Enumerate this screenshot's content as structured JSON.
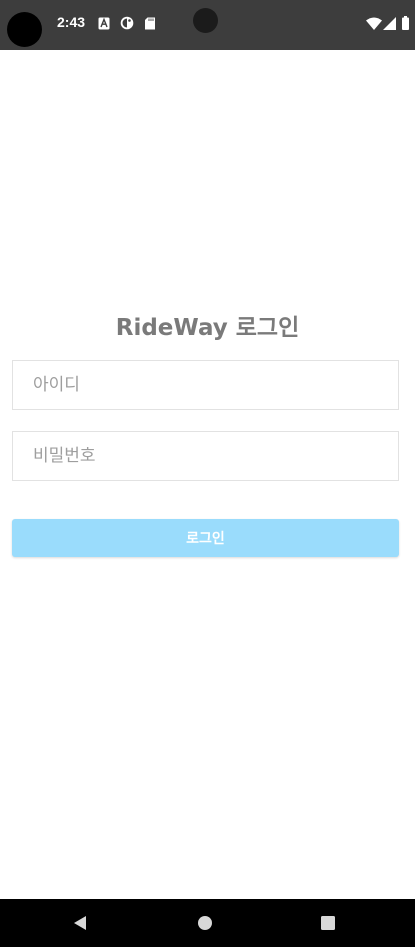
{
  "status_bar": {
    "time": "2:43",
    "notification_icons": [
      "font-icon",
      "contrast-icon",
      "sd-card-icon"
    ],
    "system_icons": [
      "wifi-icon",
      "signal-icon",
      "battery-icon"
    ]
  },
  "login": {
    "title": "RideWay 로그인",
    "id_placeholder": "아이디",
    "password_placeholder": "비밀번호",
    "login_button_label": "로그인"
  },
  "colors": {
    "status_bar_bg": "#3d3d3d",
    "title_text": "#7a7a7a",
    "button_bg": "#9adcfc",
    "field_border": "#e2e2e2",
    "nav_bar_bg": "#000000"
  },
  "nav_bar": {
    "buttons": [
      "back-icon",
      "home-icon",
      "recents-icon"
    ]
  }
}
